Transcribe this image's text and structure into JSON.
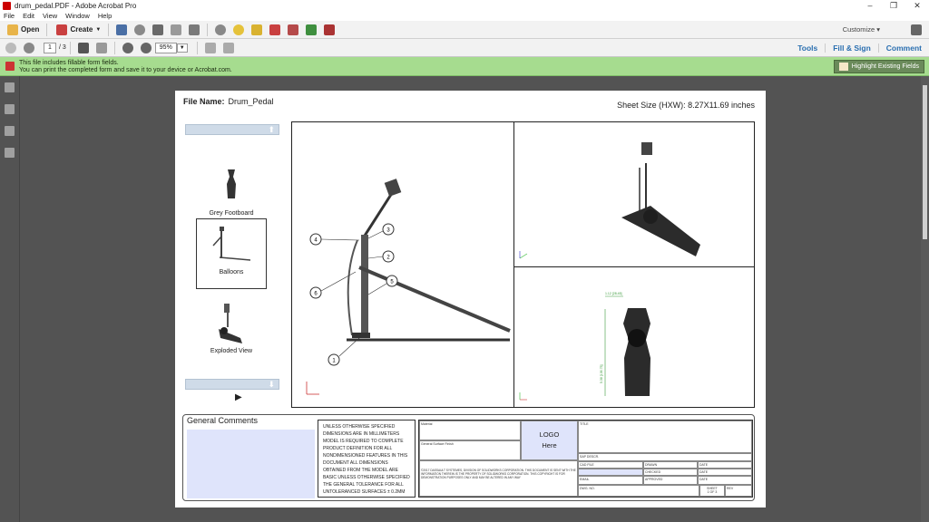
{
  "window": {
    "title": "drum_pedal.PDF - Adobe Acrobat Pro",
    "controls": [
      "–",
      "❐",
      "✕"
    ]
  },
  "menu": [
    "File",
    "Edit",
    "View",
    "Window",
    "Help"
  ],
  "toolbar": {
    "open_label": "Open",
    "create_label": "Create",
    "customize_label": "Customize"
  },
  "nav": {
    "page_current": "1",
    "page_total": "/ 3",
    "zoom": "95%"
  },
  "right_links": {
    "tools": "Tools",
    "fill_sign": "Fill & Sign",
    "comment": "Comment"
  },
  "notice": {
    "line1": "This file includes fillable form fields.",
    "line2": "You can print the completed form and save it to your device or Acrobat.com.",
    "button": "Highlight Existing Fields"
  },
  "doc": {
    "file_name_label": "File Name:",
    "file_name": "Drum_Pedal",
    "sheet_size": "Sheet Size (HXW): 8.27X11.69 inches",
    "thumbs": [
      {
        "label": "Grey Footboard"
      },
      {
        "label": "Balloons"
      },
      {
        "label": "Exploded View"
      }
    ],
    "balloons": [
      "1",
      "2",
      "3",
      "4",
      "5",
      "6"
    ],
    "dimension_top": "1.12 [28.45]",
    "dimension_side": "5.38 [136.75]",
    "general_comments": "General Comments",
    "notes": "UNLESS OTHERWISE SPECIFIED DIMENSIONS ARE IN MILLIMETERS MODEL IS REQUIRED TO COMPLETE PRODUCT DEFINITION FOR ALL NONDIMENSIONED FEATURES IN THIS DOCUMENT ALL DIMENSIONS OBTAINED FROM THE MODEL ARE BASIC UNLESS OTHERWISE SPECIFIED THE GENERAL TOLERANCE FOR ALL UNTOLERANCED SURFACES ± 0.2MM INTERPRET DRAWING IN ACCORDANCE WITH ASME Y14.5-2009 AND ASME Y14.100-2013",
    "logo_line1": "LOGO",
    "logo_line2": "Here",
    "tb": {
      "material": "Material",
      "finish": "General Surface Finish",
      "copyright": "©2017 DASSAULT SYSTEMES, DIVISION OF SOLIDWORKS CORPORATION. THIS DOCUMENT IS SENT WITH THE INFORMATION THEREIN IS THE PROPERTY OF SOLIDWORKS CORPORATION. THIS COPYRIGHT IS FOR DEMONSTRATION PURPOSES ONLY AND MAY BE ALTERED IN ANY WAY",
      "title": "TITLE",
      "sap": "SAP DESCR.",
      "cad": "CAD FILE",
      "email": "EMAIL",
      "dwg": "DWG. NO.",
      "drawn": "DRAWN",
      "checked": "CHECKED",
      "approved": "APPROVED",
      "date": "DATE",
      "sheet": "SHEET",
      "sheet_of": "1 OF 3",
      "rev": "REV"
    }
  },
  "colors": {
    "accent": "#2a6fb0",
    "notice_bg": "#a6dc8f",
    "field": "#dfe4fb"
  }
}
